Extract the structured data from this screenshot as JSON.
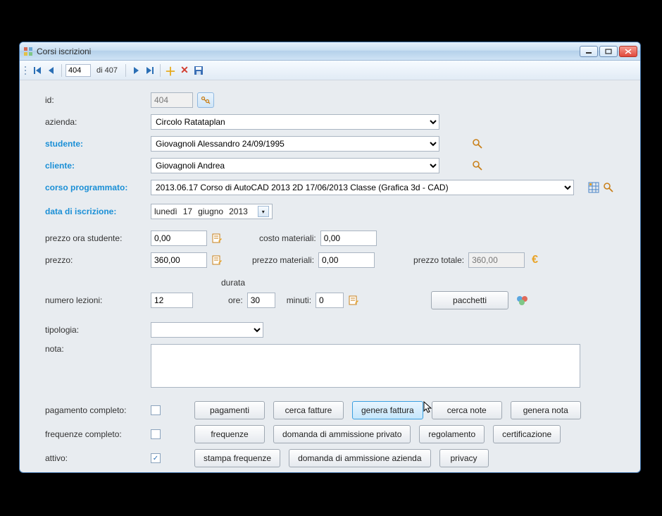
{
  "window": {
    "title": "Corsi iscrizioni"
  },
  "nav": {
    "position": "404",
    "total_prefix": "di",
    "total": "407"
  },
  "labels": {
    "id": "id:",
    "azienda": "azienda:",
    "studente": "studente:",
    "cliente": "cliente:",
    "corso": "corso programmato:",
    "data_iscrizione": "data di iscrizione:",
    "prezzo_ora_studente": "prezzo ora studente:",
    "prezzo": "prezzo:",
    "numero_lezioni": "numero lezioni:",
    "tipologia": "tipologia:",
    "nota": "nota:",
    "costo_materiali": "costo materiali:",
    "prezzo_materiali": "prezzo materiali:",
    "prezzo_totale": "prezzo totale:",
    "durata": "durata",
    "ore": "ore:",
    "minuti": "minuti:",
    "pagamento_completo": "pagamento completo:",
    "frequenze_completo": "frequenze completo:",
    "attivo": "attivo:"
  },
  "values": {
    "id": "404",
    "azienda": "Circolo Ratataplan",
    "studente": "Giovagnoli Alessandro 24/09/1995",
    "cliente": "Giovagnoli Andrea",
    "corso": "2013.06.17 Corso di AutoCAD 2013 2D 17/06/2013 Classe (Grafica 3d - CAD)",
    "data_iscrizione": {
      "weekday": "lunedì",
      "day": "17",
      "month": "giugno",
      "year": "2013"
    },
    "prezzo_ora_studente": "0,00",
    "prezzo": "360,00",
    "costo_materiali": "0,00",
    "prezzo_materiali": "0,00",
    "prezzo_totale": "360,00",
    "numero_lezioni": "12",
    "ore": "30",
    "minuti": "0",
    "tipologia": "",
    "nota": "",
    "pagamento_completo": false,
    "frequenze_completo": false,
    "attivo": true
  },
  "buttons": {
    "pacchetti": "pacchetti",
    "pagamenti": "pagamenti",
    "cerca_fatture": "cerca fatture",
    "genera_fattura": "genera fattura",
    "cerca_note": "cerca note",
    "genera_nota": "genera nota",
    "frequenze": "frequenze",
    "domanda_privato": "domanda di ammissione privato",
    "regolamento": "regolamento",
    "certificazione": "certificazione",
    "stampa_frequenze": "stampa frequenze",
    "domanda_azienda": "domanda di ammissione azienda",
    "privacy": "privacy"
  }
}
